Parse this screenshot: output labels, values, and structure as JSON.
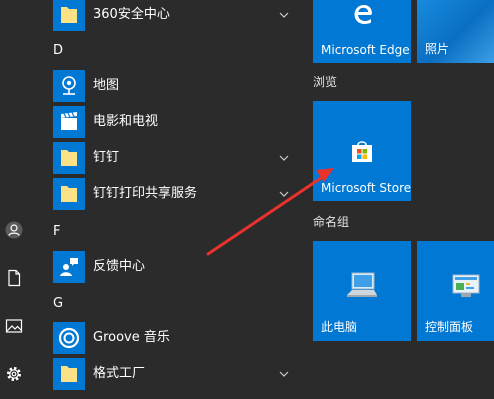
{
  "app_list": {
    "items": [
      {
        "label": "360安全中心",
        "type": "folder"
      },
      {
        "letter": "D"
      },
      {
        "label": "地图",
        "type": "maps"
      },
      {
        "label": "电影和电视",
        "type": "movies"
      },
      {
        "label": "钉钉",
        "type": "folder"
      },
      {
        "label": "钉钉打印共享服务",
        "type": "folder"
      },
      {
        "letter": "F"
      },
      {
        "label": "反馈中心",
        "type": "feedback"
      },
      {
        "letter": "G"
      },
      {
        "label": "Groove 音乐",
        "type": "groove"
      },
      {
        "label": "格式工厂",
        "type": "folder"
      }
    ]
  },
  "tiles": {
    "edge_label": "Microsoft Edge",
    "photos_label": "照片",
    "browse_group": "浏览",
    "store_label": "Microsoft Store",
    "unnamed_group": "命名组",
    "thispc_label": "此电脑",
    "controlpanel_label": "控制面板"
  },
  "icons": [
    "user-icon",
    "document-icon",
    "pictures-icon",
    "settings-icon",
    "folder-icon",
    "maps-icon",
    "film-icon",
    "feedback-icon",
    "groove-icon",
    "chevron-down-icon",
    "edge-icon",
    "store-icon",
    "computer-icon",
    "control-panel-icon"
  ],
  "colors": {
    "background": "#2b2b2b",
    "tile_blue": "#0078d4",
    "folder_yellow": "#fce186",
    "annotation_arrow": "#e8322b"
  }
}
